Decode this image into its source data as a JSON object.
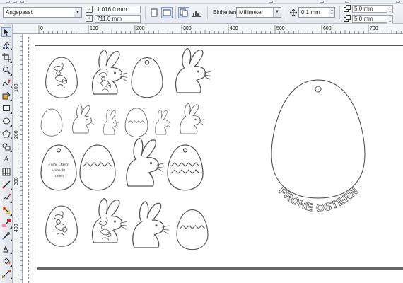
{
  "propbar": {
    "preset_value": "Angepasst",
    "width_value": "1.016,0 mm",
    "height_value": "711,0 mm",
    "units_label": "Einheiten:",
    "units_value": "Millimeter",
    "nudge_value": "0,1 mm",
    "dup_x_value": "5,0 mm",
    "dup_y_value": "5,0 mm"
  },
  "ruler": {
    "h_labels": [
      "0",
      "100",
      "200",
      "300",
      "400",
      "500",
      "600",
      "700"
    ],
    "v_labels": [
      "100",
      "200",
      "300",
      "400"
    ]
  },
  "canvas": {
    "egg_text_small": "Frohe Ostern\nwünscht\ncomeo",
    "big_egg_text": "FROHE OSTERN"
  },
  "tools": [
    "pick-tool",
    "shape-tool",
    "crop-tool",
    "zoom-tool",
    "freehand-tool",
    "smart-fill-tool",
    "rectangle-tool",
    "ellipse-tool",
    "polygon-tool",
    "basic-shapes-tool",
    "text-tool",
    "table-tool",
    "dimension-tool",
    "connector-tool",
    "blend-tool",
    "transparency-tool",
    "eyedropper-tool",
    "outline-tool",
    "fill-tool",
    "interactive-fill-tool"
  ]
}
